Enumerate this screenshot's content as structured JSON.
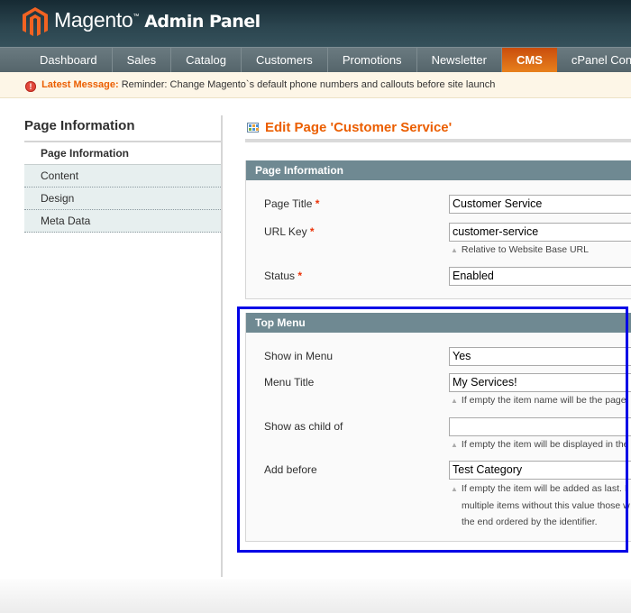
{
  "header": {
    "brand": "Magento",
    "brand_sub": "Admin Panel",
    "trademark": "™"
  },
  "nav": {
    "items": [
      {
        "label": "Dashboard",
        "active": false
      },
      {
        "label": "Sales",
        "active": false
      },
      {
        "label": "Catalog",
        "active": false
      },
      {
        "label": "Customers",
        "active": false
      },
      {
        "label": "Promotions",
        "active": false
      },
      {
        "label": "Newsletter",
        "active": false
      },
      {
        "label": "CMS",
        "active": true
      },
      {
        "label": "cPanel Connector",
        "active": false
      }
    ]
  },
  "message": {
    "icon": "!",
    "label": "Latest Message:",
    "text": "Reminder: Change Magento`s default phone numbers and callouts before site launch"
  },
  "sidebar": {
    "title": "Page Information",
    "tabs": [
      {
        "label": "Page Information",
        "active": true
      },
      {
        "label": "Content",
        "active": false
      },
      {
        "label": "Design",
        "active": false
      },
      {
        "label": "Meta Data",
        "active": false
      }
    ]
  },
  "main": {
    "title": "Edit Page 'Customer Service'",
    "page_info": {
      "legend": "Page Information",
      "fields": {
        "page_title": {
          "label": "Page Title",
          "required": "*",
          "value": "Customer Service"
        },
        "url_key": {
          "label": "URL Key",
          "required": "*",
          "value": "customer-service",
          "note": "Relative to Website Base URL"
        },
        "status": {
          "label": "Status",
          "required": "*",
          "value": "Enabled"
        }
      }
    },
    "top_menu": {
      "legend": "Top Menu",
      "fields": {
        "show_in_menu": {
          "label": "Show in Menu",
          "value": "Yes"
        },
        "menu_title": {
          "label": "Menu Title",
          "value": "My Services!",
          "note": "If empty the item name will be the page"
        },
        "show_as_child": {
          "label": "Show as child of",
          "value": "",
          "note": "If empty the item will be displayed in the"
        },
        "add_before": {
          "label": "Add before",
          "value": "Test Category",
          "note_lines": [
            "If empty the item will be added as last. I",
            "multiple items without this value those w",
            "the end ordered by the identifier."
          ]
        }
      }
    }
  },
  "colors": {
    "accent": "#eb5e00",
    "nav_active": "#e8811c",
    "fieldset_head": "#6f8992",
    "highlight": "#0000e6"
  }
}
